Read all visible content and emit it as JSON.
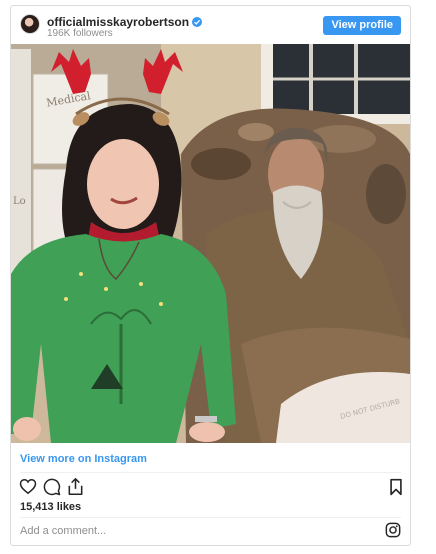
{
  "post": {
    "username": "officialmisskayrobertson",
    "followers": "196K followers",
    "view_profile_label": "View profile",
    "view_more_label": "View more on Instagram",
    "likes": "15,413 likes",
    "comment_placeholder": "Add a comment...",
    "photo": {
      "cabinet_label_medical": "Medical",
      "cabinet_label_2": "Lo",
      "blanket_text": "DO NOT DISTURB"
    }
  },
  "colors": {
    "accent": "#3897f0",
    "border": "#dbdbdb",
    "muted": "#8e8e8e",
    "text": "#262626"
  },
  "icons": [
    "verified-badge-icon",
    "heart-icon",
    "comment-icon",
    "share-icon",
    "bookmark-icon",
    "instagram-icon"
  ]
}
